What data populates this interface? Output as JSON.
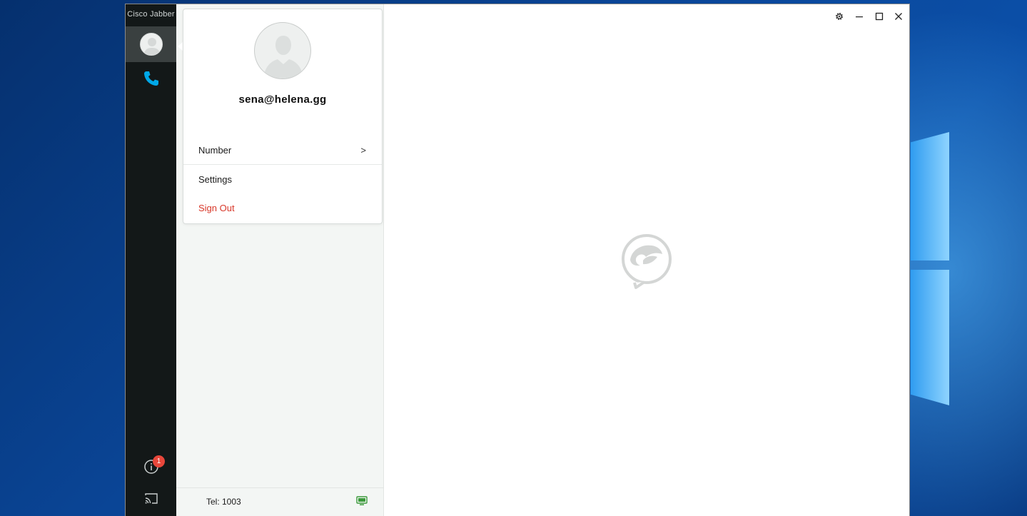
{
  "app": {
    "title": "Cisco Jabber"
  },
  "rail": {
    "notification_count": "1",
    "icons": [
      "avatar",
      "phone-icon",
      "info-icon",
      "cast-icon"
    ],
    "accent_color": "#00a8e8",
    "badge_color": "#e8473b"
  },
  "profile_menu": {
    "email": "sena@helena.gg",
    "items": [
      {
        "label": "Number",
        "chevron": ">"
      },
      {
        "label": "Settings"
      },
      {
        "label": "Sign Out",
        "color": "#d8382a"
      }
    ]
  },
  "footer": {
    "tel": "Tel:  1003"
  },
  "window_controls": [
    "gear-icon",
    "minimize-icon",
    "maximize-icon",
    "close-icon"
  ]
}
